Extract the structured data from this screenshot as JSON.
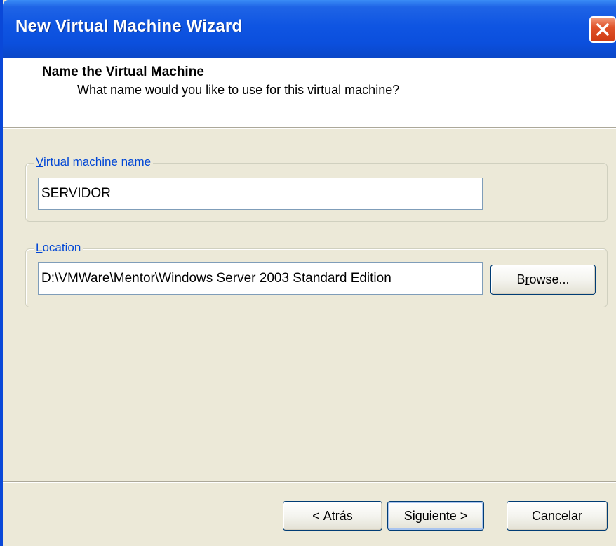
{
  "window": {
    "title": "New Virtual Machine Wizard"
  },
  "header": {
    "title": "Name the Virtual Machine",
    "subtitle": "What name would you like to use for this virtual machine?"
  },
  "name_group": {
    "label_mnemonic": "V",
    "label_rest": "irtual machine name",
    "value": "SERVIDOR"
  },
  "location_group": {
    "label_mnemonic": "L",
    "label_rest": "ocation",
    "value": "D:\\VMWare\\Mentor\\Windows Server 2003 Standard Edition",
    "browse_pre": "B",
    "browse_mnemonic": "r",
    "browse_post": "owse..."
  },
  "footer": {
    "back_pre": "< ",
    "back_mnemonic": "A",
    "back_post": "trás",
    "next_pre": "Siguie",
    "next_mnemonic": "n",
    "next_post": "te >",
    "cancel_label": "Cancelar"
  },
  "colors": {
    "titlebar": "#0b4fdd",
    "close_button": "#e0532a",
    "group_label": "#0046d5",
    "dialog_face": "#ece9d8"
  },
  "icons": {
    "close": "close-icon"
  }
}
